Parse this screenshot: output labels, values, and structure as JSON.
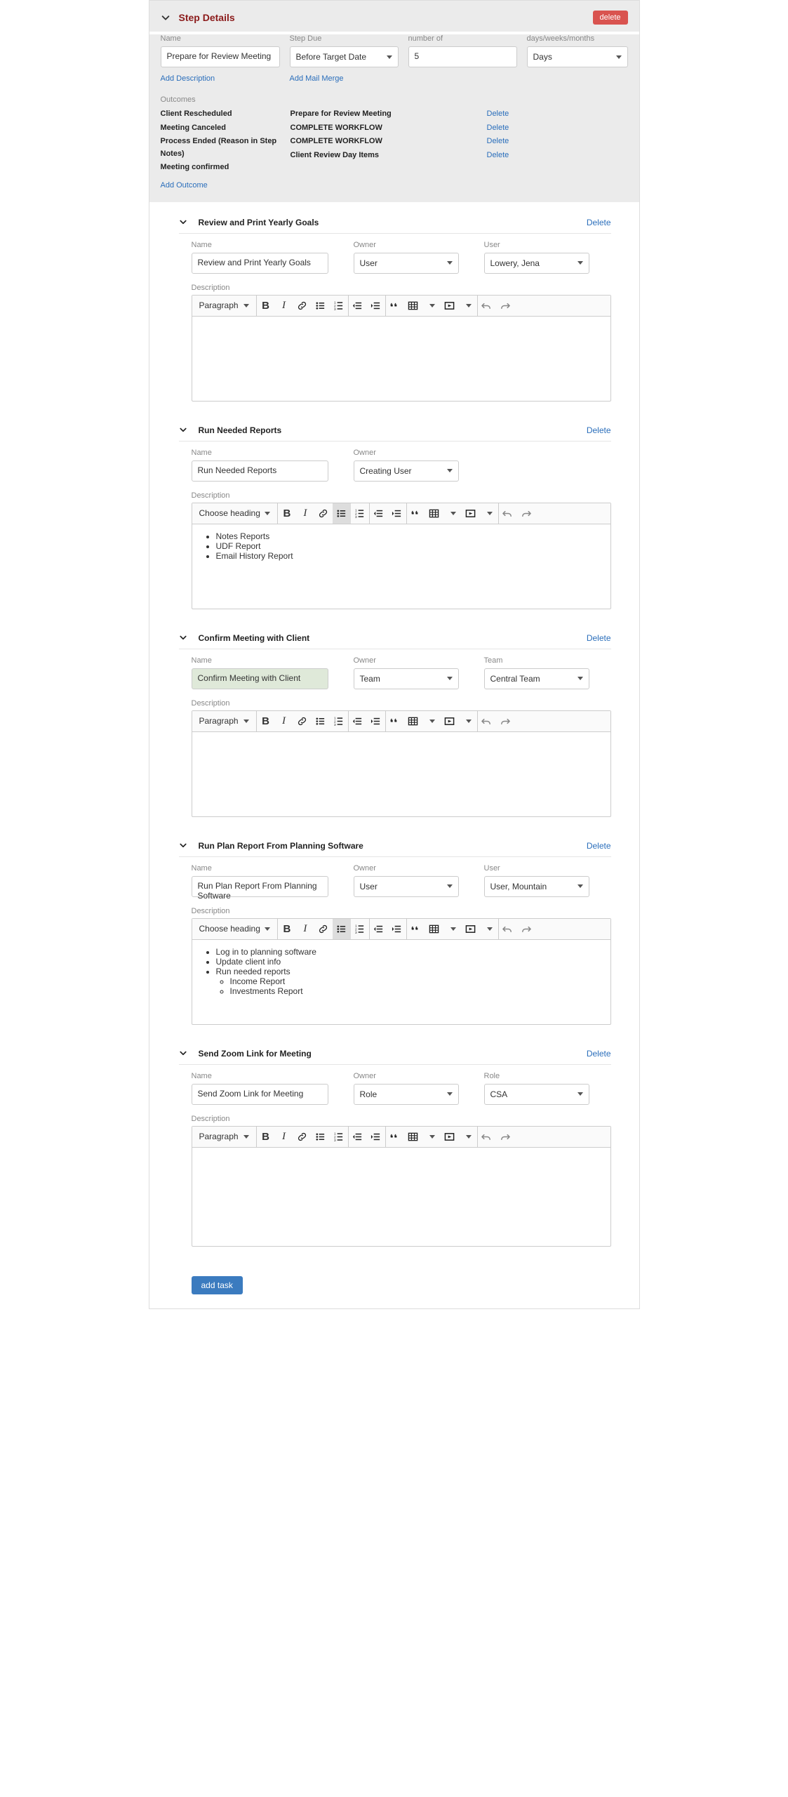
{
  "header": {
    "title": "Step Details",
    "delete": "delete"
  },
  "step": {
    "name_label": "Name",
    "name_value": "Prepare for Review Meeting",
    "due_label": "Step Due",
    "due_value": "Before Target Date",
    "number_label": "number of",
    "number_value": "5",
    "unit_label": "days/weeks/months",
    "unit_value": "Days",
    "add_description": "Add Description",
    "add_mail_merge": "Add Mail Merge",
    "outcomes_label": "Outcomes",
    "add_outcome": "Add Outcome",
    "delete_label": "Delete",
    "outcomes": [
      {
        "name": "Client Rescheduled",
        "action": "Prepare for Review Meeting"
      },
      {
        "name": "Meeting Canceled",
        "action": "COMPLETE WORKFLOW"
      },
      {
        "name": "Process Ended (Reason in Step Notes)",
        "action": "COMPLETE WORKFLOW"
      },
      {
        "name": "Meeting confirmed",
        "action": "Client Review Day Items"
      }
    ]
  },
  "labels": {
    "name": "Name",
    "owner": "Owner",
    "user": "User",
    "team": "Team",
    "role": "Role",
    "description": "Description",
    "delete": "Delete",
    "add_task": "add task",
    "paragraph": "Paragraph",
    "choose_heading": "Choose heading"
  },
  "tasks": [
    {
      "title": "Review and Print Yearly Goals",
      "name": "Review and Print Yearly Goals",
      "owner": "User",
      "assignee_label": "User",
      "assignee": "Lowery, Jena",
      "heading_sel": "Paragraph",
      "bullets_active": false,
      "content": null
    },
    {
      "title": "Run Needed Reports",
      "name": "Run Needed Reports",
      "owner": "Creating User",
      "assignee_label": null,
      "assignee": null,
      "heading_sel": "Choose heading",
      "bullets_active": true,
      "content": {
        "type": "ul",
        "items": [
          "Notes Reports",
          "UDF Report",
          "Email History Report"
        ]
      }
    },
    {
      "title": "Confirm Meeting with Client",
      "name": "Confirm Meeting with Client",
      "owner": "Team",
      "assignee_label": "Team",
      "assignee": "Central Team",
      "heading_sel": "Paragraph",
      "bullets_active": false,
      "content": null,
      "name_highlighted": true
    },
    {
      "title": "Run Plan Report From Planning Software",
      "name": "Run Plan Report From Planning Software",
      "owner": "User",
      "assignee_label": "User",
      "assignee": "User, Mountain",
      "heading_sel": "Choose heading",
      "bullets_active": true,
      "content": {
        "type": "ul",
        "items": [
          "Log in to planning software",
          "Update client info",
          {
            "text": "Run needed reports",
            "sub": [
              "Income Report",
              "Investments Report"
            ]
          }
        ]
      }
    },
    {
      "title": "Send Zoom Link for Meeting",
      "name": "Send Zoom Link for Meeting",
      "owner": "Role",
      "assignee_label": "Role",
      "assignee": "CSA",
      "heading_sel": "Paragraph",
      "bullets_active": false,
      "content": null
    }
  ]
}
